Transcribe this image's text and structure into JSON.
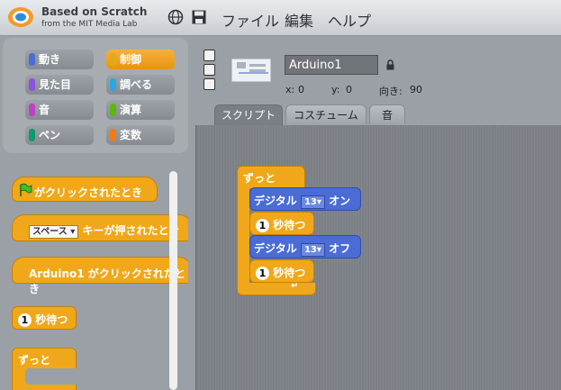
{
  "header": {
    "brand_line1": "Based on Scratch",
    "brand_line2": "from the MIT Media Lab",
    "menus": [
      "ファイル",
      "編集",
      "ヘルプ"
    ]
  },
  "categories": [
    {
      "label": "動き",
      "color": "#4a6cd4",
      "selected": false
    },
    {
      "label": "制御",
      "color": "#e1a91a",
      "selected": true
    },
    {
      "label": "見た目",
      "color": "#8a55d7",
      "selected": false
    },
    {
      "label": "調べる",
      "color": "#2ca5e2",
      "selected": false
    },
    {
      "label": "音",
      "color": "#bb42c3",
      "selected": false
    },
    {
      "label": "演算",
      "color": "#5cb712",
      "selected": false
    },
    {
      "label": "ペン",
      "color": "#0e9a6c",
      "selected": false
    },
    {
      "label": "変数",
      "color": "#ee7d16",
      "selected": false
    }
  ],
  "palette": {
    "flag_block": "がクリックされたとき",
    "key_dropdown": "スペース",
    "key_block": "キーが押されたとき",
    "sprite_block": "Arduino1 がクリックされたとき",
    "wait_num": "1",
    "wait_label": "秒待つ",
    "forever_label": "ずっと"
  },
  "sprite": {
    "name": "Arduino1",
    "x_label": "x:",
    "x": "0",
    "y_label": "y:",
    "y": "0",
    "dir_label": "向き:",
    "direction": "90"
  },
  "tabs": [
    {
      "label": "スクリプト",
      "active": true
    },
    {
      "label": "コスチューム",
      "active": false
    },
    {
      "label": "音",
      "active": false
    }
  ],
  "script": {
    "forever_label": "ずっと",
    "digital_label": "デジタル",
    "pin": "13",
    "on_label": "オン",
    "off_label": "オフ",
    "wait_num": "1",
    "wait_label": "秒待つ"
  },
  "colors": {
    "control": "#f0a81a",
    "arduino": "#4a6cd4",
    "script_bg": "#7b8086"
  }
}
